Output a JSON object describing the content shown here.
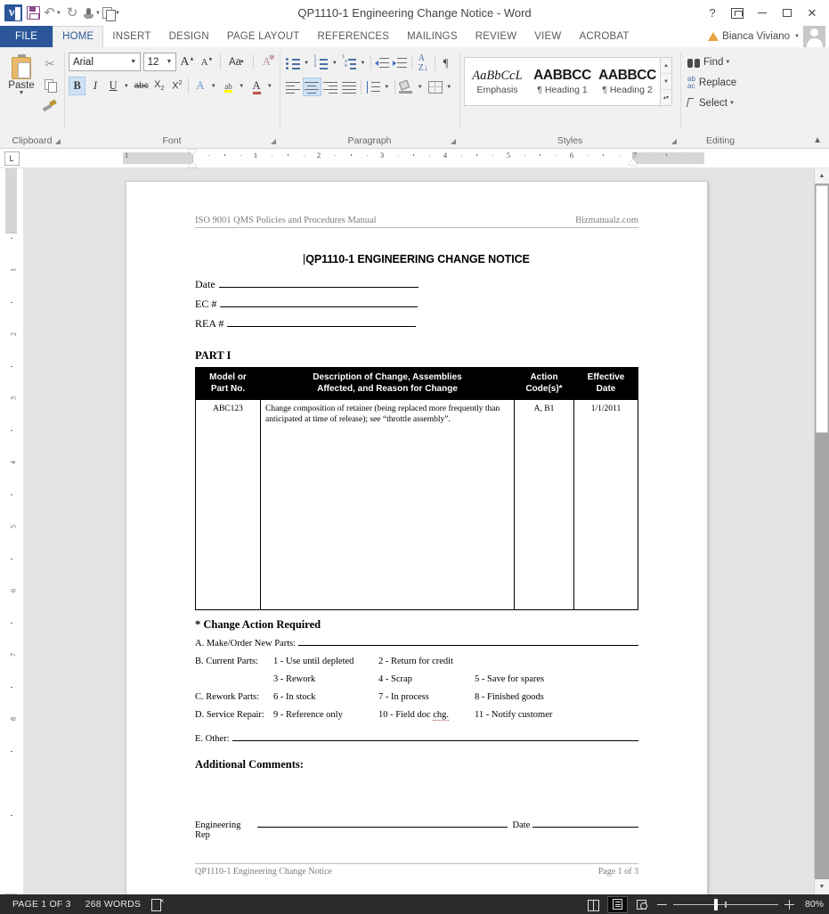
{
  "window": {
    "title": "QP1110-1 Engineering Change Notice - Word",
    "quick_access": [
      {
        "name": "word-logo",
        "label": "W"
      },
      {
        "name": "save-icon",
        "label": "Save"
      },
      {
        "name": "undo-icon",
        "label": "Undo"
      },
      {
        "name": "redo-icon",
        "label": "Redo"
      },
      {
        "name": "touch-mode-icon",
        "label": "Touch/Mouse Mode"
      },
      {
        "name": "customize-icon",
        "label": "Customize Quick Access Toolbar"
      }
    ],
    "controls": {
      "help": "?",
      "ribbon_display": "Ribbon Display Options",
      "minimize": "Minimize",
      "maximize": "Maximize",
      "close": "✕"
    }
  },
  "tabs": [
    {
      "label": "FILE",
      "active": false
    },
    {
      "label": "HOME",
      "active": true
    },
    {
      "label": "INSERT",
      "active": false
    },
    {
      "label": "DESIGN",
      "active": false
    },
    {
      "label": "PAGE LAYOUT",
      "active": false
    },
    {
      "label": "REFERENCES",
      "active": false
    },
    {
      "label": "MAILINGS",
      "active": false
    },
    {
      "label": "REVIEW",
      "active": false
    },
    {
      "label": "VIEW",
      "active": false
    },
    {
      "label": "ACROBAT",
      "active": false
    }
  ],
  "account": {
    "name": "Bianca Viviano",
    "warning_icon": "warning-triangle-icon"
  },
  "ribbon": {
    "groups": [
      {
        "name": "clipboard",
        "label": "Clipboard"
      },
      {
        "name": "font",
        "label": "Font"
      },
      {
        "name": "paragraph",
        "label": "Paragraph"
      },
      {
        "name": "styles",
        "label": "Styles"
      },
      {
        "name": "editing",
        "label": "Editing"
      }
    ],
    "clipboard": {
      "paste_label": "Paste",
      "cut_label": "Cut",
      "copy_label": "Copy",
      "format_painter_label": "Format Painter"
    },
    "font": {
      "font_name": "Arial",
      "font_size": "12",
      "grow_label": "A",
      "shrink_label": "A",
      "change_case_label": "Aa",
      "clear_formatting_label": "Clear All Formatting",
      "bold_label": "B",
      "italic_label": "I",
      "underline_label": "U",
      "strike_label": "abc",
      "subscript_label": "X",
      "superscript_label": "X",
      "text_effects_label": "A",
      "highlight_label": "ab",
      "font_color_label": "A",
      "font_color_hex": "#c0504d",
      "highlight_color_hex": "#ffff00"
    },
    "paragraph": {
      "bullets_label": "Bullets",
      "numbering_label": "Numbering",
      "multilevel_label": "Multilevel List",
      "decrease_indent_label": "Decrease Indent",
      "increase_indent_label": "Increase Indent",
      "sort_label": "Sort",
      "show_marks_label": "¶",
      "align_left_label": "Align Left",
      "align_center_label": "Center",
      "align_right_label": "Align Right",
      "justify_label": "Justify",
      "line_spacing_label": "Line and Paragraph Spacing",
      "shading_label": "Shading",
      "borders_label": "Borders"
    },
    "styles": {
      "items": [
        {
          "preview": "AaBbCcL",
          "name": "Emphasis",
          "kind": "emph"
        },
        {
          "preview": "AABBCC",
          "name": "¶ Heading 1",
          "kind": "h1"
        },
        {
          "preview": "AABBCC",
          "name": "¶ Heading 2",
          "kind": "h1"
        }
      ]
    },
    "editing": {
      "find_label": "Find",
      "replace_label": "Replace",
      "select_label": "Select"
    },
    "collapse_label": "Collapse the Ribbon"
  },
  "ruler": {
    "tab_stop_label": "L",
    "horizontal_marks": [
      "1",
      "1",
      "2",
      "3",
      "4",
      "5",
      "6",
      "7"
    ],
    "vertical_marks": [
      "1",
      "2",
      "3",
      "4",
      "5",
      "6",
      "7",
      "8"
    ]
  },
  "document": {
    "header": {
      "left": "ISO 9001 QMS Policies and Procedures Manual",
      "right": "Bizmanualz.com"
    },
    "title": "QP1110-1 ENGINEERING CHANGE NOTICE",
    "fields": [
      {
        "label": "Date",
        "value": ""
      },
      {
        "label": "EC #",
        "value": ""
      },
      {
        "label": "REA #",
        "value": ""
      }
    ],
    "part_heading": "PART I",
    "table": {
      "headers": [
        "Model or\nPart No.",
        "Description of Change, Assemblies\nAffected, and Reason for Change",
        "Action\nCode(s)*",
        "Effective\nDate"
      ],
      "header_lines": [
        [
          "Model or",
          "Part No."
        ],
        [
          "Description of Change, Assemblies",
          "Affected, and Reason for Change"
        ],
        [
          "Action",
          "Code(s)*"
        ],
        [
          "Effective",
          "Date"
        ]
      ],
      "rows": [
        {
          "model": "ABC123",
          "description": "Change composition of retainer (being replaced more frequently than anticipated at time of release); see “throttle assembly”.",
          "action_codes": "A, B1",
          "effective_date": "1/1/2011"
        }
      ]
    },
    "change_action_heading": "* Change Action Required",
    "make_order_label": "A. Make/Order New Parts:",
    "code_rows": [
      {
        "cat": "B. Current Parts:",
        "c1": "1 - Use until depleted",
        "c2": "2 - Return for credit",
        "c3": ""
      },
      {
        "cat": "",
        "c1": "3 - Rework",
        "c2": "4 - Scrap",
        "c3": "5 - Save for spares"
      },
      {
        "cat": "C. Rework Parts:",
        "c1": "6 - In stock",
        "c2": "7 - In process",
        "c3": "8 - Finished goods"
      },
      {
        "cat": "D. Service Repair:",
        "c1": "9 - Reference only",
        "c2": "10 - Field doc chg.",
        "c3": "11 - Notify customer",
        "spell": "chg."
      }
    ],
    "other_label": "E. Other:",
    "additional_comments": "Additional Comments:",
    "signature": {
      "rep_label": "Engineering Rep",
      "date_label": "Date"
    },
    "footer": {
      "left": "QP1110-1 Engineering Change Notice",
      "right": "Page 1 of 3"
    }
  },
  "statusbar": {
    "page": "PAGE 1 OF 3",
    "words": "268 WORDS",
    "proofing_icon": "proofing-errors-icon",
    "views": [
      {
        "name": "read-mode",
        "selected": false
      },
      {
        "name": "print-layout",
        "selected": true
      },
      {
        "name": "web-layout",
        "selected": false
      }
    ],
    "zoom": "80%"
  }
}
